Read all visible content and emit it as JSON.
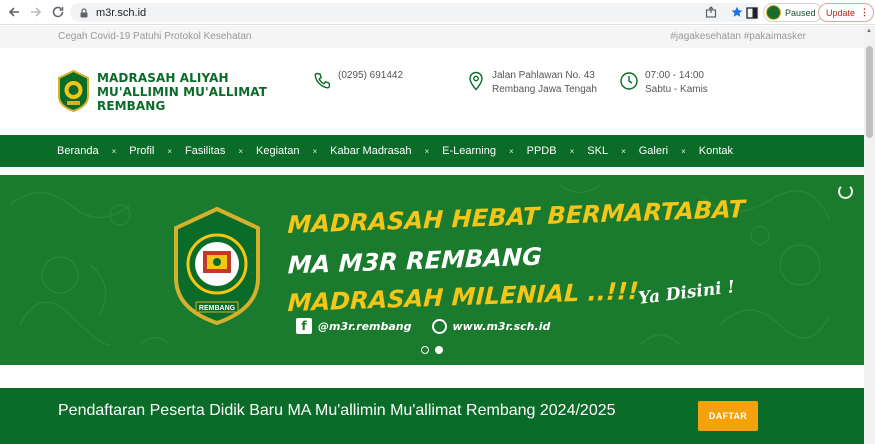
{
  "browser": {
    "url": "m3r.sch.id",
    "profile_label": "Paused",
    "update_label": "Update"
  },
  "topbar": {
    "left_text": "Cegah Covid-19 Patuhi Protokol Kesehatan",
    "right_text": "#jagakesehatan #pakaimasker"
  },
  "header": {
    "name_line1": "MADRASAH ALIYAH",
    "name_line2": "MU'ALLIMIN MU'ALLIMAT",
    "name_line3": "REMBANG",
    "phone": "(0295) 691442",
    "address_line1": "Jalan Pahlawan No. 43",
    "address_line2": "Rembang Jawa Tengah",
    "hours_line1": "07:00 - 14:00",
    "hours_line2": "Sabtu - Kamis"
  },
  "nav": {
    "items": [
      "Beranda",
      "Profil",
      "Fasilitas",
      "Kegiatan",
      "Kabar Madrasah",
      "E-Learning",
      "PPDB",
      "SKL",
      "Galeri",
      "Kontak"
    ],
    "separator": "×"
  },
  "hero": {
    "line1": "MADRASAH HEBAT BERMARTABAT",
    "line2": "MA M3R REMBANG",
    "line3": "MADRASAH MILENIAL ..!!!",
    "facebook": "@m3r.rembang",
    "website": "www.m3r.sch.id",
    "tagline": "Ya Disini !",
    "logo_label": "REMBANG",
    "slides": 2,
    "active_slide": 2
  },
  "registration": {
    "text": "Pendaftaran Peserta Didik Baru MA Mu'allimin Mu'allimat Rembang 2024/2025",
    "button": "DAFTAR"
  },
  "colors": {
    "primary_green": "#0b6b28",
    "hero_green": "#1a7a2e",
    "accent_yellow": "#f5c518",
    "button_orange": "#f5a10a"
  }
}
